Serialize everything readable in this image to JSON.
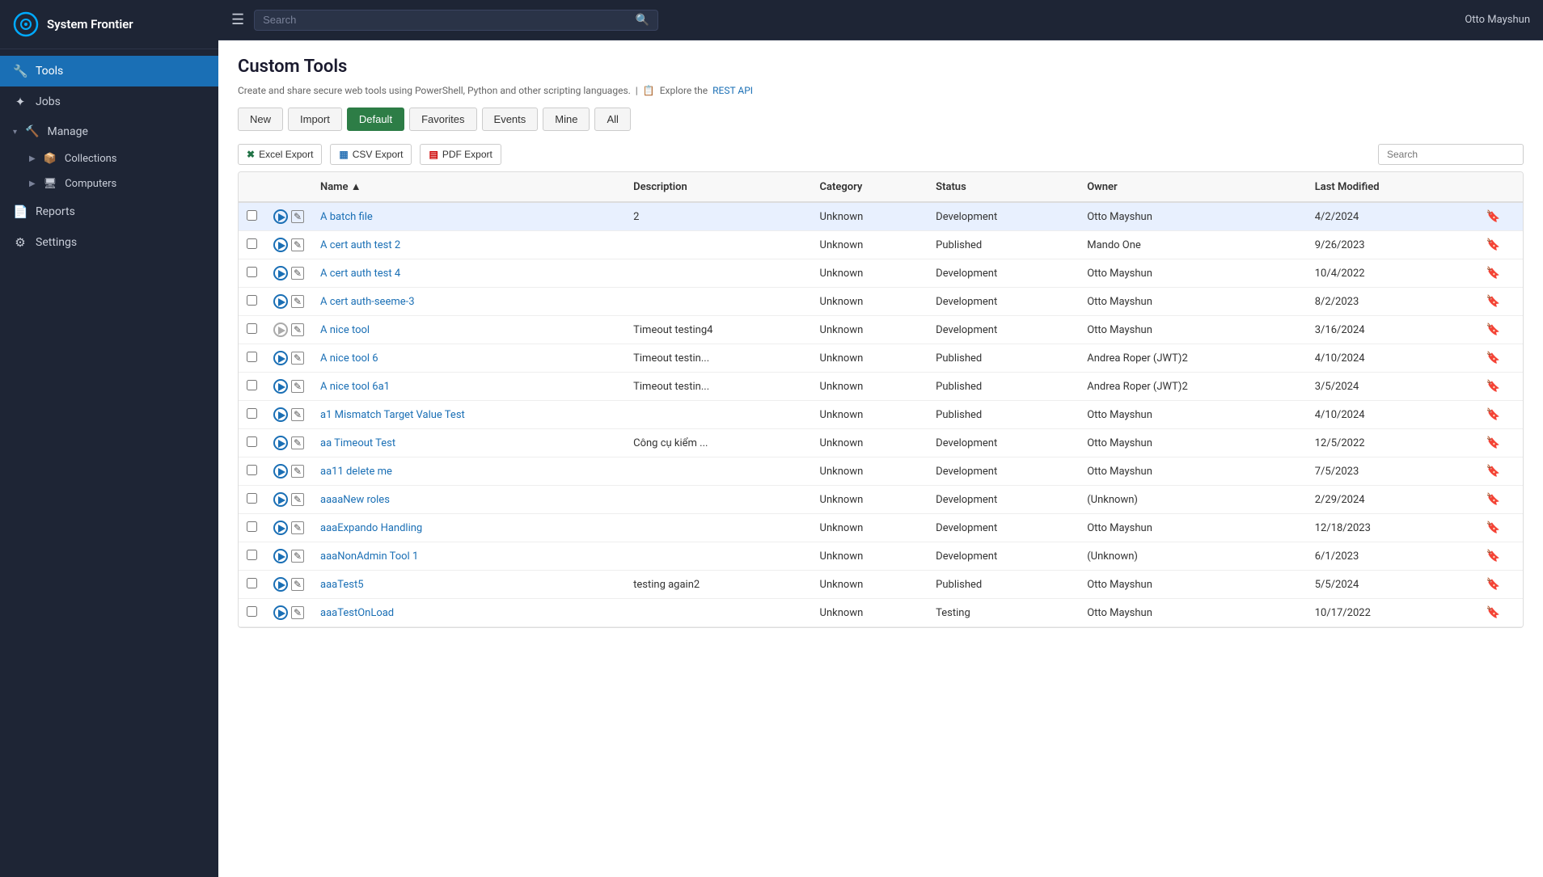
{
  "app": {
    "name": "System Frontier",
    "user": "Otto Mayshun"
  },
  "topbar": {
    "search_placeholder": "Search"
  },
  "sidebar": {
    "items": [
      {
        "id": "tools",
        "label": "Tools",
        "icon": "🔧",
        "active": true
      },
      {
        "id": "jobs",
        "label": "Jobs",
        "icon": "⚙"
      },
      {
        "id": "manage",
        "label": "Manage",
        "icon": "🔨"
      }
    ],
    "sub_items": [
      {
        "id": "collections",
        "label": "Collections",
        "icon": "📦"
      },
      {
        "id": "computers",
        "label": "Computers",
        "icon": "🖥"
      }
    ],
    "bottom_items": [
      {
        "id": "reports",
        "label": "Reports",
        "icon": "📄"
      },
      {
        "id": "settings",
        "label": "Settings",
        "icon": "⚙"
      }
    ]
  },
  "page": {
    "title": "Custom Tools",
    "description": "Create and share secure web tools using PowerShell, Python and other scripting languages.",
    "description_separator": "|",
    "api_icon": "📋",
    "api_text": "Explore the",
    "api_link": "REST API"
  },
  "toolbar": {
    "buttons": [
      {
        "id": "new",
        "label": "New",
        "style": "default"
      },
      {
        "id": "import",
        "label": "Import",
        "style": "default"
      },
      {
        "id": "default",
        "label": "Default",
        "style": "active"
      },
      {
        "id": "favorites",
        "label": "Favorites",
        "style": "default"
      },
      {
        "id": "events",
        "label": "Events",
        "style": "default"
      },
      {
        "id": "mine",
        "label": "Mine",
        "style": "default"
      },
      {
        "id": "all",
        "label": "All",
        "style": "default"
      }
    ]
  },
  "table": {
    "exports": [
      {
        "id": "excel",
        "label": "Excel Export",
        "icon": "✖"
      },
      {
        "id": "csv",
        "label": "CSV Export",
        "icon": "▦"
      },
      {
        "id": "pdf",
        "label": "PDF Export",
        "icon": "▤"
      }
    ],
    "search_placeholder": "Search",
    "columns": [
      "",
      "",
      "Name",
      "Description",
      "Category",
      "Status",
      "Owner",
      "Last Modified"
    ],
    "rows": [
      {
        "name": "A batch file",
        "description": "2",
        "category": "Unknown",
        "status": "Development",
        "owner": "Otto Mayshun",
        "last_modified": "4/2/2024",
        "bookmark": false,
        "play_disabled": false,
        "highlighted": true
      },
      {
        "name": "A cert auth test 2",
        "description": "",
        "category": "Unknown",
        "status": "Published",
        "owner": "Mando One",
        "last_modified": "9/26/2023",
        "bookmark": false,
        "play_disabled": false
      },
      {
        "name": "A cert auth test 4",
        "description": "",
        "category": "Unknown",
        "status": "Development",
        "owner": "Otto Mayshun",
        "last_modified": "10/4/2022",
        "bookmark": false,
        "play_disabled": false
      },
      {
        "name": "A cert auth-seeme-3",
        "description": "",
        "category": "Unknown",
        "status": "Development",
        "owner": "Otto Mayshun",
        "last_modified": "8/2/2023",
        "bookmark": false,
        "play_disabled": false
      },
      {
        "name": "A nice tool",
        "description": "Timeout testing4",
        "category": "Unknown",
        "status": "Development",
        "owner": "Otto Mayshun",
        "last_modified": "3/16/2024",
        "bookmark": true,
        "play_disabled": true
      },
      {
        "name": "A nice tool 6",
        "description": "Timeout testin...",
        "category": "Unknown",
        "status": "Published",
        "owner": "Andrea Roper (JWT)2",
        "last_modified": "4/10/2024",
        "bookmark": true,
        "play_disabled": false
      },
      {
        "name": "A nice tool 6a1",
        "description": "Timeout testin...",
        "category": "Unknown",
        "status": "Published",
        "owner": "Andrea Roper (JWT)2",
        "last_modified": "3/5/2024",
        "bookmark": false,
        "play_disabled": false
      },
      {
        "name": "a1 Mismatch Target Value Test",
        "description": "",
        "category": "Unknown",
        "status": "Published",
        "owner": "Otto Mayshun",
        "last_modified": "4/10/2024",
        "bookmark": true,
        "play_disabled": false
      },
      {
        "name": "aa Timeout Test",
        "description": "Công cụ kiểm ...",
        "category": "Unknown",
        "status": "Development",
        "owner": "Otto Mayshun",
        "last_modified": "12/5/2022",
        "bookmark": false,
        "play_disabled": false
      },
      {
        "name": "aa11 delete me",
        "description": "",
        "category": "Unknown",
        "status": "Development",
        "owner": "Otto Mayshun",
        "last_modified": "7/5/2023",
        "bookmark": false,
        "play_disabled": false
      },
      {
        "name": "aaaaNew roles",
        "description": "",
        "category": "Unknown",
        "status": "Development",
        "owner": "(Unknown)",
        "last_modified": "2/29/2024",
        "bookmark": false,
        "play_disabled": false
      },
      {
        "name": "aaaExpando Handling",
        "description": "",
        "category": "Unknown",
        "status": "Development",
        "owner": "Otto Mayshun",
        "last_modified": "12/18/2023",
        "bookmark": false,
        "play_disabled": false
      },
      {
        "name": "aaaNonAdmin Tool 1",
        "description": "",
        "category": "Unknown",
        "status": "Development",
        "owner": "(Unknown)",
        "last_modified": "6/1/2023",
        "bookmark": false,
        "play_disabled": false
      },
      {
        "name": "aaaTest5",
        "description": "testing again2",
        "category": "Unknown",
        "status": "Published",
        "owner": "Otto Mayshun",
        "last_modified": "5/5/2024",
        "bookmark": true,
        "play_disabled": false
      },
      {
        "name": "aaaTestOnLoad",
        "description": "",
        "category": "Unknown",
        "status": "Testing",
        "owner": "Otto Mayshun",
        "last_modified": "10/17/2022",
        "bookmark": false,
        "play_disabled": false
      }
    ]
  }
}
